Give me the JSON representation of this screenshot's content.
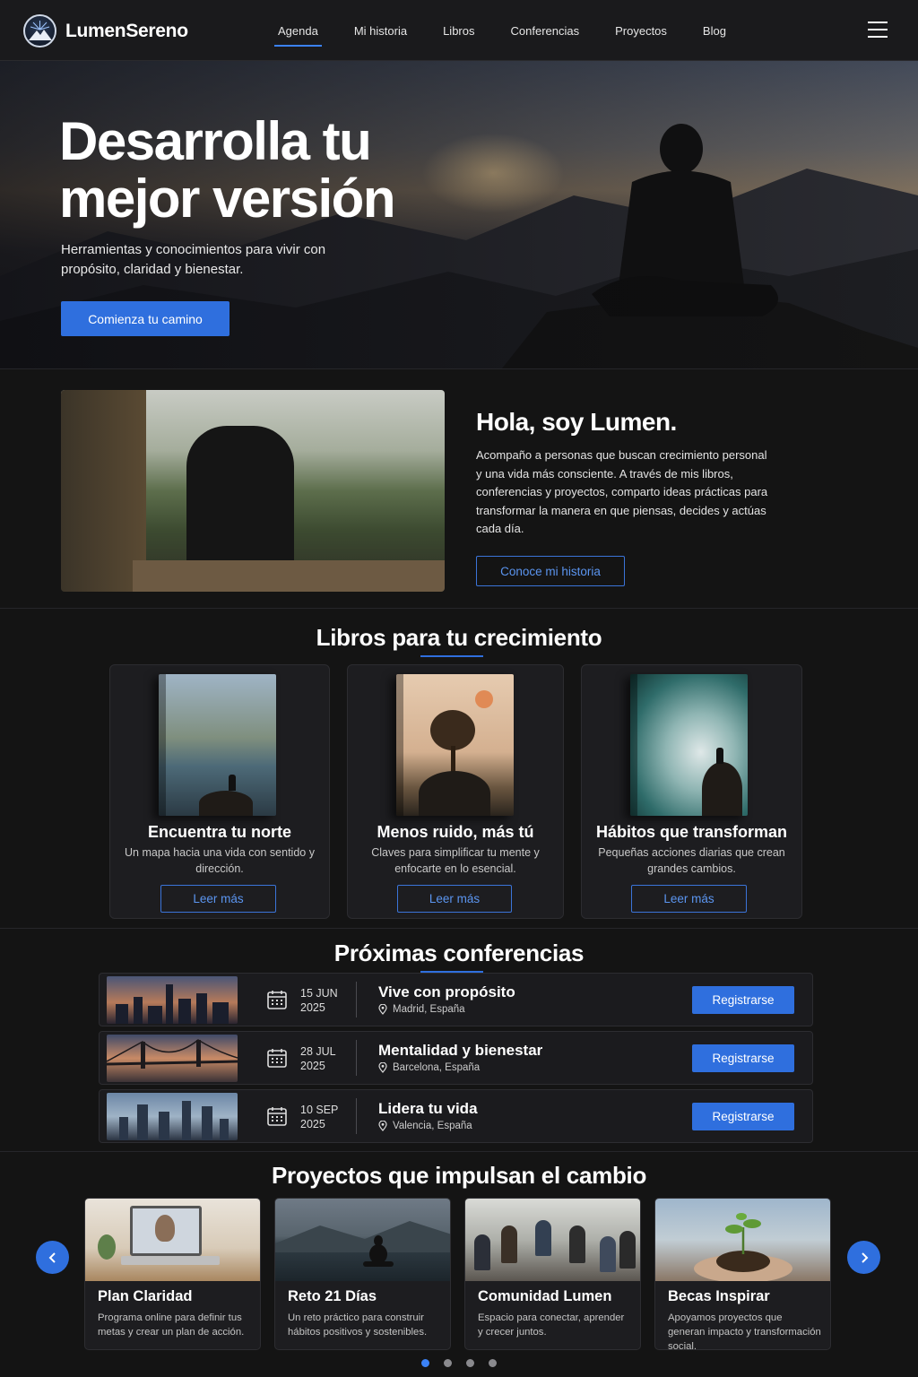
{
  "brand": {
    "name": "LumenSereno"
  },
  "nav": {
    "items": [
      {
        "label": "Agenda",
        "active": true
      },
      {
        "label": "Mi historia"
      },
      {
        "label": "Libros"
      },
      {
        "label": "Conferencias"
      },
      {
        "label": "Proyectos"
      },
      {
        "label": "Blog"
      }
    ],
    "menu_icon": "hamburger-icon"
  },
  "hero": {
    "title": "Desarrolla tu mejor versión",
    "subtitle": "Herramientas y conocimientos para vivir con propósito, claridad y bienestar.",
    "cta": "Comienza tu camino"
  },
  "about": {
    "title": "Hola, soy Lumen.",
    "text": "Acompaño a personas que buscan crecimiento personal y una vida más consciente. A través de mis libros, conferencias y proyectos, comparto ideas prácticas para transformar la manera en que piensas, decides y actúas cada día.",
    "cta": "Conoce mi historia"
  },
  "books": {
    "title": "Libros para tu crecimiento",
    "items": [
      {
        "title": "Encuentra tu norte",
        "desc": "Un mapa hacia una vida con sentido y dirección.",
        "cta": "Leer más"
      },
      {
        "title": "Menos ruido, más tú",
        "desc": "Claves para simplificar tu mente y enfocarte en lo esencial.",
        "cta": "Leer más"
      },
      {
        "title": "Hábitos que transforman",
        "desc": "Pequeñas acciones diarias que crean grandes cambios.",
        "cta": "Leer más"
      }
    ]
  },
  "conferences": {
    "title": "Próximas conferencias",
    "items": [
      {
        "day": "15 JUN",
        "year": "2025",
        "title": "Vive con propósito",
        "location": "Madrid, España",
        "cta": "Registrarse"
      },
      {
        "day": "28 JUL",
        "year": "2025",
        "title": "Mentalidad y bienestar",
        "location": "Barcelona, España",
        "cta": "Registrarse"
      },
      {
        "day": "10 SEP",
        "year": "2025",
        "title": "Lidera tu vida",
        "location": "Valencia, España",
        "cta": "Registrarse"
      }
    ]
  },
  "projects": {
    "title": "Proyectos que impulsan el cambio",
    "items": [
      {
        "title": "Plan Claridad",
        "desc": "Programa online para definir tus metas y crear un plan de acción."
      },
      {
        "title": "Reto 21 Días",
        "desc": "Un reto práctico para construir hábitos positivos y sostenibles."
      },
      {
        "title": "Comunidad Lumen",
        "desc": "Espacio para conectar, aprender y crecer juntos."
      },
      {
        "title": "Becas Inspirar",
        "desc": "Apoyamos proyectos que generan impacto y transformación social."
      }
    ],
    "prev_icon": "chevron-left-icon",
    "next_icon": "chevron-right-icon",
    "pages": 4,
    "current_page": 1
  },
  "colors": {
    "accent": "#2f6fde",
    "background": "#141414",
    "card": "#1d1d20"
  }
}
